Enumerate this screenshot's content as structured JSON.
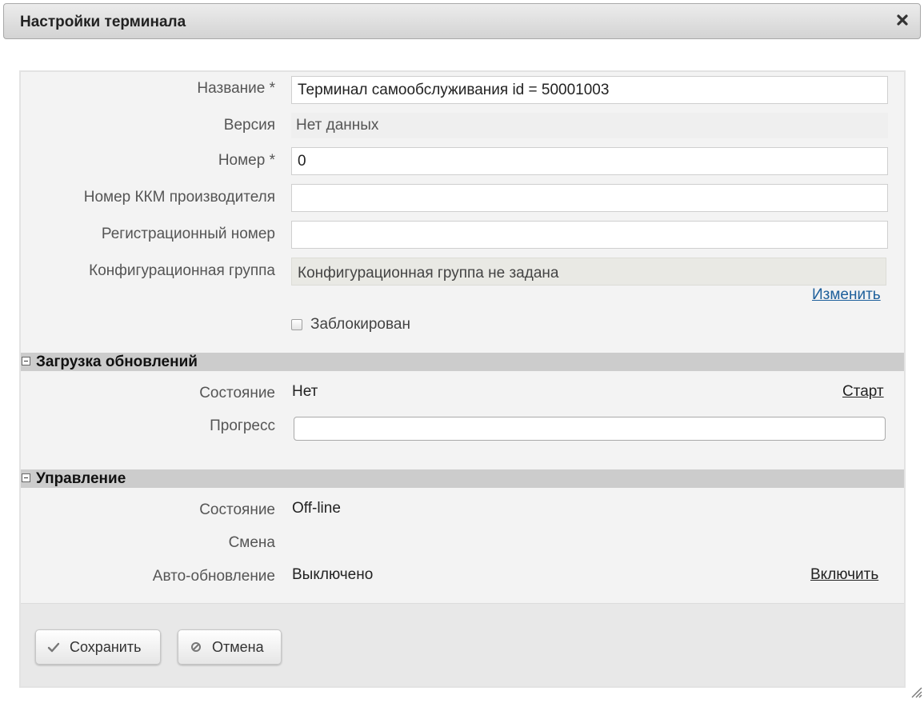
{
  "dialog": {
    "title": "Настройки терминала",
    "close_icon": "close-icon"
  },
  "form": {
    "name": {
      "label": "Название *",
      "value": "Терминал самообслуживания id = 50001003"
    },
    "version": {
      "label": "Версия",
      "value": "Нет данных"
    },
    "number": {
      "label": "Номер *",
      "value": "0"
    },
    "kkm_number": {
      "label": "Номер ККМ производителя",
      "value": ""
    },
    "reg_number": {
      "label": "Регистрационный номер",
      "value": ""
    },
    "config_group": {
      "label": "Конфигурационная группа",
      "value": "Конфигурационная группа не задана",
      "change_link": "Изменить"
    },
    "blocked": {
      "label": "Заблокирован",
      "checked": false
    }
  },
  "updates": {
    "title": "Загрузка обновлений",
    "state_label": "Состояние",
    "state_value": "Нет",
    "start_link": "Старт",
    "progress_label": "Прогресс",
    "progress_fraction": 0
  },
  "control": {
    "title": "Управление",
    "state_label": "Состояние",
    "state_value": "Off-line",
    "shift_label": "Смена",
    "shift_value": "",
    "autoupdate_label": "Авто-обновление",
    "autoupdate_value": "Выключено",
    "enable_link": "Включить"
  },
  "footer": {
    "save_label": "Сохранить",
    "cancel_label": "Отмена"
  },
  "colors": {
    "link_blue": "#1d5f9b",
    "section_bg": "#cccccc",
    "panel_bg": "#f3f3f3"
  }
}
